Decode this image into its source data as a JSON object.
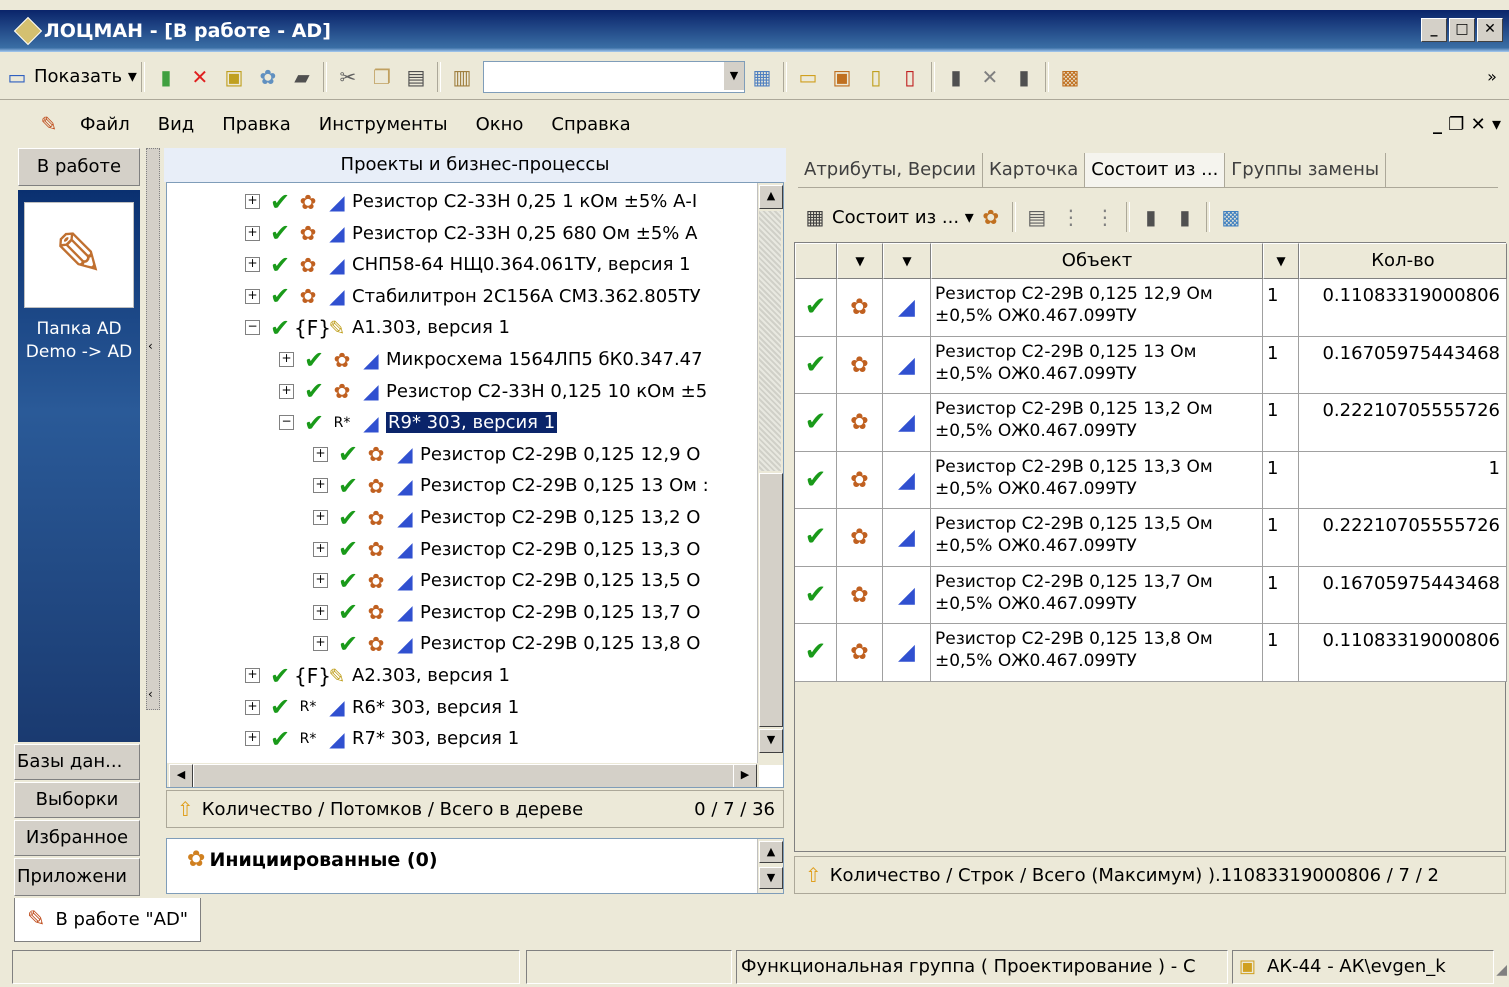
{
  "window": {
    "title": "ЛОЦМАН - [В работе - AD]"
  },
  "toolbar": {
    "show_label": "Показать"
  },
  "menu": [
    "Файл",
    "Вид",
    "Правка",
    "Инструменты",
    "Окно",
    "Справка"
  ],
  "left_nav": {
    "top_tab": "В работе",
    "folder_label": "Папка AD Demo -> AD",
    "bottom_tabs": [
      "Базы дан...",
      "Выборки",
      "Избранное",
      "Приложени"
    ]
  },
  "tree_panel": {
    "header": "Проекты и бизнес-процессы",
    "rows": [
      {
        "label": "Резистор С2-33Н 0,25 1 кОм ±5% А-I",
        "indent": 0,
        "type": "item"
      },
      {
        "label": "Резистор С2-33Н 0,25 680 Ом ±5% А",
        "indent": 0,
        "type": "item"
      },
      {
        "label": "СНП58-64 НЩ0.364.061ТУ, версия  1",
        "indent": 0,
        "type": "item"
      },
      {
        "label": "Стабилитрон 2С156А СМ3.362.805ТУ",
        "indent": 0,
        "type": "item"
      },
      {
        "label": "А1.303, версия  1",
        "indent": 0,
        "type": "func",
        "expanded": true
      },
      {
        "label": "Микросхема 1564ЛП5 бК0.347.47",
        "indent": 1,
        "type": "item"
      },
      {
        "label": "Резистор С2-33Н 0,125 10 кОм ±5",
        "indent": 1,
        "type": "item"
      },
      {
        "label": "R9* 303, версия  1",
        "indent": 1,
        "type": "group",
        "expanded": true,
        "selected": true
      },
      {
        "label": "Резистор С2-29В 0,125 12,9 О",
        "indent": 2,
        "type": "item"
      },
      {
        "label": "Резистор С2-29В 0,125 13 Ом :",
        "indent": 2,
        "type": "item"
      },
      {
        "label": "Резистор С2-29В 0,125 13,2 О",
        "indent": 2,
        "type": "item"
      },
      {
        "label": "Резистор С2-29В 0,125 13,3 О",
        "indent": 2,
        "type": "item"
      },
      {
        "label": "Резистор С2-29В 0,125 13,5 О",
        "indent": 2,
        "type": "item"
      },
      {
        "label": "Резистор С2-29В 0,125 13,7 О",
        "indent": 2,
        "type": "item"
      },
      {
        "label": "Резистор С2-29В 0,125 13,8 О",
        "indent": 2,
        "type": "item"
      },
      {
        "label": "А2.303, версия  1",
        "indent": 0,
        "type": "func"
      },
      {
        "label": "R6* 303, версия  1",
        "indent": 0,
        "type": "group"
      },
      {
        "label": "R7* 303, версия  1",
        "indent": 0,
        "type": "group"
      }
    ],
    "status_label": "Количество / Потомков / Всего в дереве",
    "status_value": "0 / 7 / 36"
  },
  "bp_panel": {
    "item1": "Инициированные (0)"
  },
  "right_panel": {
    "tabs": [
      "Атрибуты, Версии",
      "Карточка",
      "Состоит из ...",
      "Группы замены"
    ],
    "active_tab": 2,
    "toolbar_label": "Состоит из ...",
    "columns": {
      "object": "Объект",
      "qty": "Кол-во"
    },
    "rows": [
      {
        "object": "Резистор С2-29В 0,125 12,9 Ом\n±0,5%  ОЖ0.467.099ТУ",
        "count": "1",
        "qty": "0.11083319000806"
      },
      {
        "object": "Резистор С2-29В 0,125 13 Ом\n±0,5%  ОЖ0.467.099ТУ",
        "count": "1",
        "qty": "0.16705975443468"
      },
      {
        "object": "Резистор С2-29В 0,125 13,2 Ом\n±0,5%  ОЖ0.467.099ТУ",
        "count": "1",
        "qty": "0.22210705555726"
      },
      {
        "object": "Резистор С2-29В 0,125 13,3 Ом\n±0,5%  ОЖ0.467.099ТУ",
        "count": "1",
        "qty": "1"
      },
      {
        "object": "Резистор С2-29В 0,125 13,5 Ом\n±0,5%  ОЖ0.467.099ТУ",
        "count": "1",
        "qty": "0.22210705555726"
      },
      {
        "object": "Резистор С2-29В 0,125 13,7 Ом\n±0,5%  ОЖ0.467.099ТУ",
        "count": "1",
        "qty": "0.16705975443468"
      },
      {
        "object": "Резистор С2-29В 0,125 13,8 Ом\n±0,5%  ОЖ0.467.099ТУ",
        "count": "1",
        "qty": "0.11083319000806"
      }
    ],
    "status": "Количество / Строк / Всего (Максимум) ).11083319000806 / 7 / 2"
  },
  "doc_tab": {
    "label": "В работе \"AD\""
  },
  "statusbar": {
    "segment3": "Функциональная группа ( Проектирование ) - С",
    "segment4": "АК-44 - АК\\evgen_k"
  }
}
